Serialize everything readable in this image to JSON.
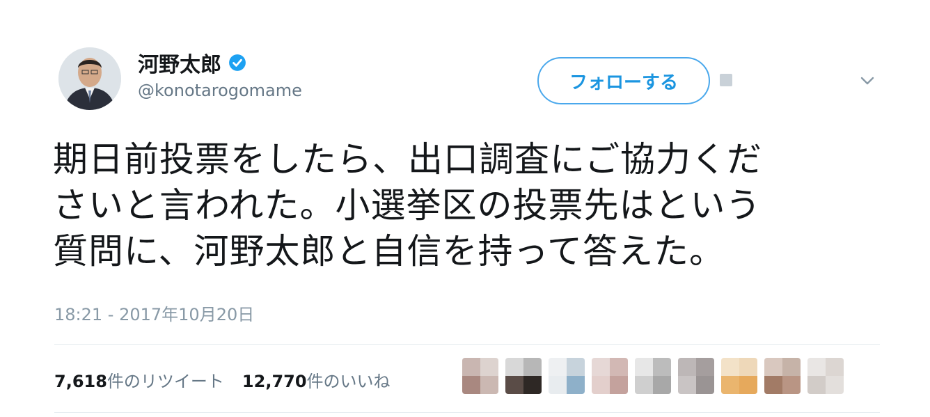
{
  "tweet": {
    "display_name": "河野太郎",
    "handle": "@konotarogomame",
    "verified": true,
    "follow_label": "フォローする",
    "text_lines": [
      "期日前投票をしたら、出口調査にご協力くだ",
      "さいと言われた。小選挙区の投票先はという",
      "質問に、河野太郎と自信を持って答えた。"
    ],
    "timestamp": "18:21 - 2017年10月20日",
    "retweets": {
      "count": "7,618",
      "label": "件のリツイート"
    },
    "likes": {
      "count": "12,770",
      "label": "件のいいね"
    },
    "liker_avatars": [
      "pixelated-avatar-1",
      "pixelated-avatar-2",
      "pixelated-avatar-3",
      "pixelated-avatar-4",
      "pixelated-avatar-5",
      "pixelated-avatar-6",
      "pixelated-avatar-7",
      "pixelated-avatar-8",
      "pixelated-avatar-9"
    ]
  },
  "colors": {
    "accent": "#1b95e0",
    "verified": "#1da1f2",
    "muted": "#657786"
  }
}
